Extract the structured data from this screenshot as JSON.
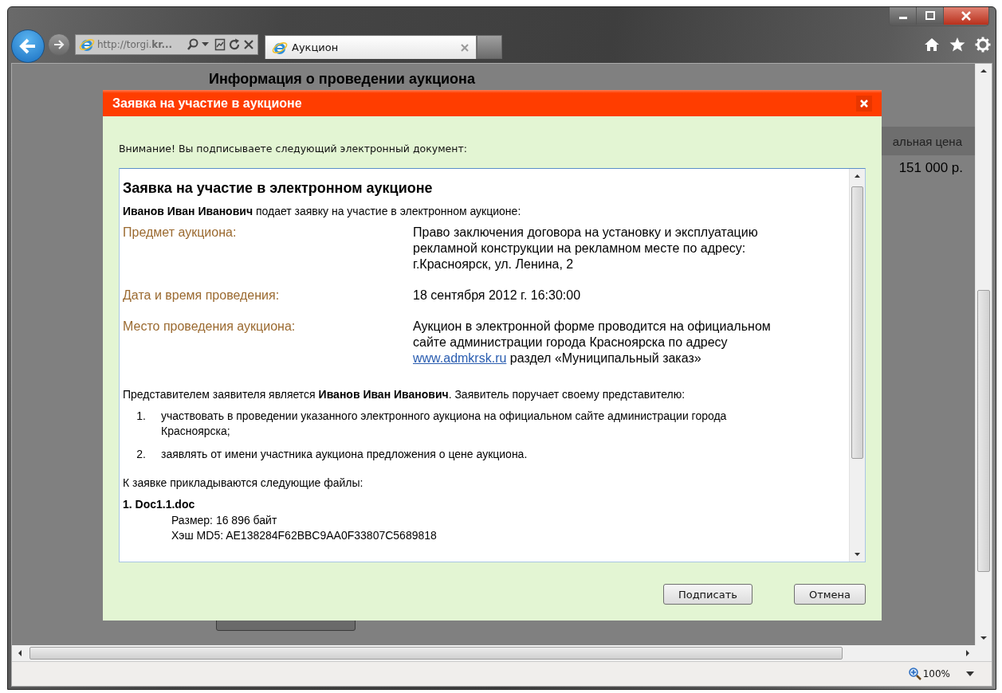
{
  "browser": {
    "address": "http://torgi.**kr...**",
    "tab_title": "Аукцион",
    "zoom": "100%"
  },
  "page": {
    "heading": "Информация о проведении аукциона",
    "table_header": "альная цена",
    "price": "151 000 р."
  },
  "dialog": {
    "title": "Заявка на участие в аукционе",
    "notice": "Внимание! Вы подписываете следующий электронный документ:",
    "document": {
      "title": "Заявка на участие в электронном аукционе",
      "applicant": "**Иванов Иван Иванович** подает заявку на участие в электронном аукционе:",
      "fields": [
        {
          "label": "Предмет аукциона:",
          "value": "Право заключения договора на установку и эксплуатацию рекламной конструкции на рекламном месте по адресу: г.Красноярск, ул. Ленина, 2"
        },
        {
          "label": "Дата и время проведения:",
          "value": "18 сентября 2012 г. 16:30:00"
        },
        {
          "label": "Место проведения аукциона:",
          "value": "Аукцион в электронной форме проводится на официальном сайте администрации города Красноярска по адресу",
          "link": "www.admkrsk.ru",
          "value_end": "раздел «Муниципальный заказ»"
        }
      ],
      "representative": "Представителем заявителя является **Иванов Иван Иванович**. Заявитель поручает своему представителю:",
      "powers": [
        {
          "number": "1.",
          "text": "участвовать в проведении указанного электронного аукциона на официальном сайте администрации города Красноярска;"
        },
        {
          "number": "2.",
          "text": "заявлять от имени участника аукциона предложения о цене аукциона."
        }
      ],
      "files_heading": "К заявке прикладываются следующие файлы:",
      "files": [
        {
          "name": "1. Doc1.1.doc",
          "size": "Размер: 16 896 байт",
          "hash": "Хэш MD5: AE138284F62BBC9AA0F33807C5689818"
        }
      ]
    },
    "buttons": [
      {
        "label": "Подписать"
      },
      {
        "label": "Отмена"
      }
    ]
  }
}
